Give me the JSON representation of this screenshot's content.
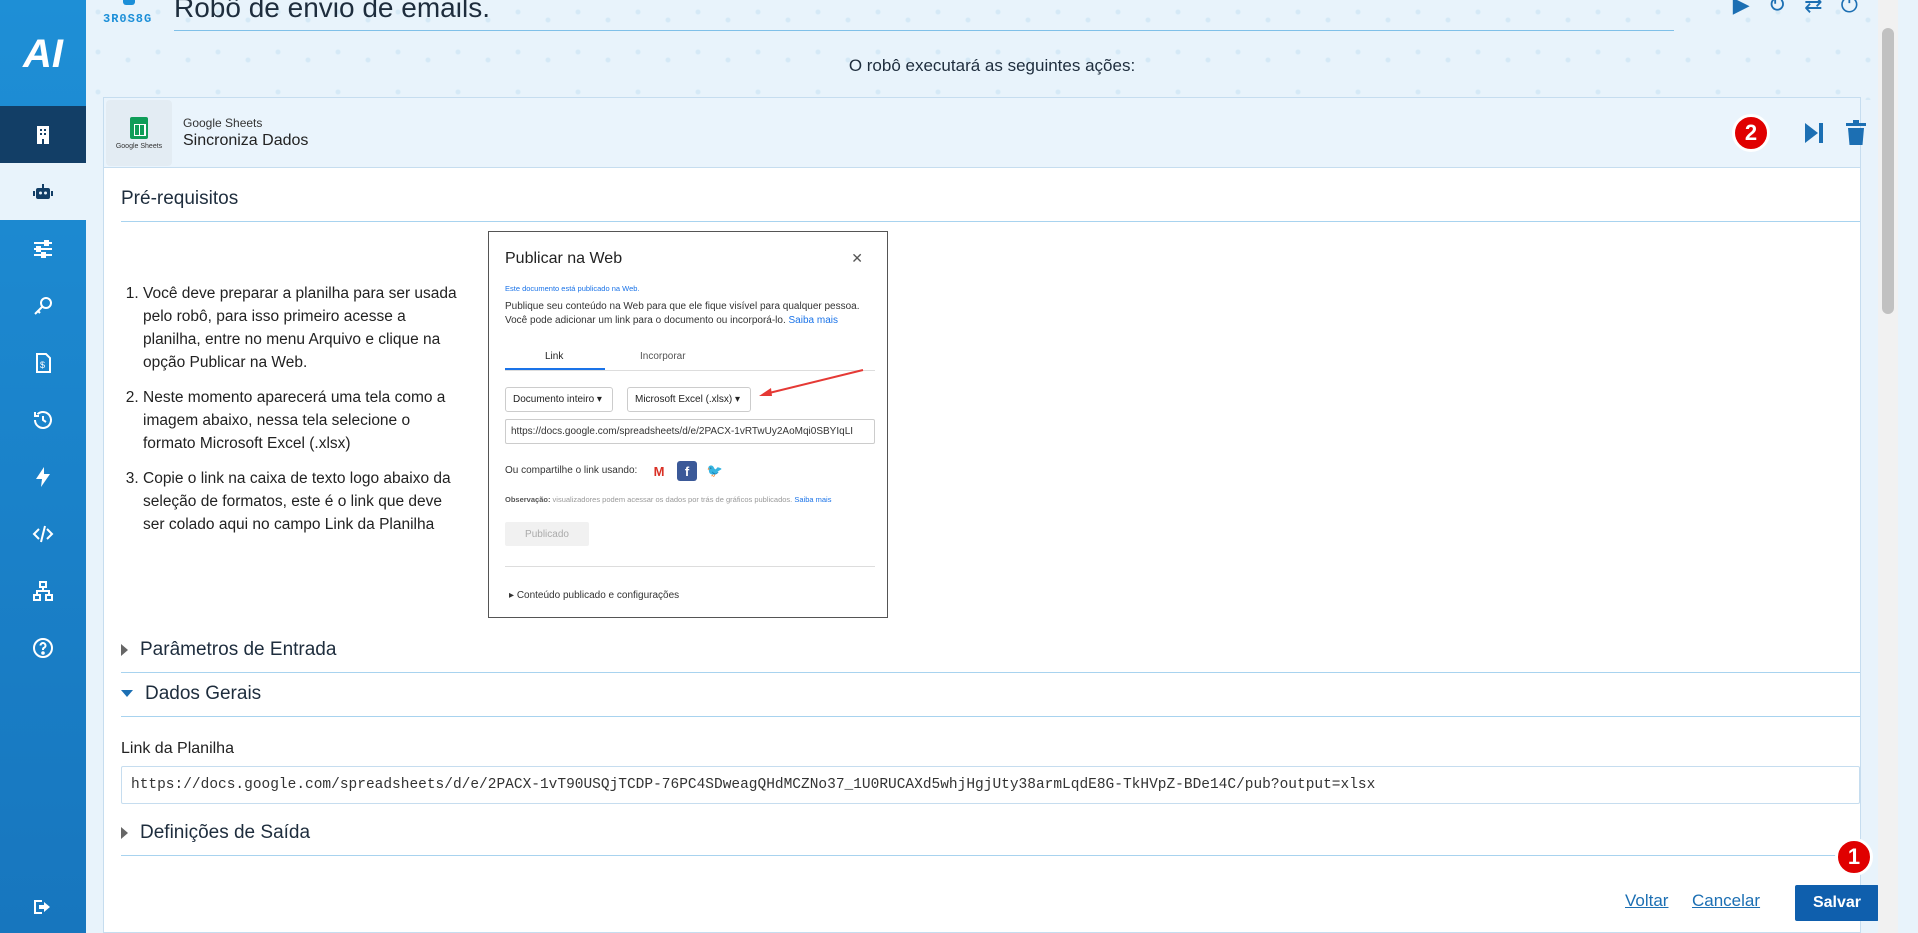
{
  "sidebar": {
    "logo": "AI",
    "items": [
      {
        "name": "building-icon"
      },
      {
        "name": "robot-icon"
      },
      {
        "name": "sliders-icon"
      },
      {
        "name": "key-icon"
      },
      {
        "name": "invoice-icon"
      },
      {
        "name": "history-icon"
      },
      {
        "name": "bolt-icon"
      },
      {
        "name": "code-icon"
      },
      {
        "name": "network-icon"
      },
      {
        "name": "help-icon"
      },
      {
        "name": "logout-icon"
      }
    ]
  },
  "header": {
    "robot_code": "3R0S8G",
    "title": "Robô de envio de emails.",
    "subtitle": "O robô executará as seguintes ações:"
  },
  "step": {
    "app_tile_label": "Google Sheets",
    "app_name": "Google Sheets",
    "step_name": "Sincroniza Dados",
    "annotation_badge": "2"
  },
  "prerequisites": {
    "title": "Pré-requisitos",
    "items": [
      "Você deve preparar a planilha para ser usada pelo robô, para isso primeiro acesse a planilha, entre no menu Arquivo e clique na opção Publicar na Web.",
      "Neste momento aparecerá uma tela como a imagem abaixo, nessa tela selecione o formato Microsoft Excel (.xlsx)",
      "Copie o link na caixa de texto logo abaixo da seleção de formatos, este é o link que deve ser colado aqui no campo Link da Planilha"
    ],
    "screenshot": {
      "title": "Publicar na Web",
      "published_note": "Este documento está publicado na Web.",
      "description": "Publique seu conteúdo na Web para que ele fique visível para qualquer pessoa. Você pode adicionar um link para o documento ou incorporá-lo.",
      "learn_more": "Saiba mais",
      "tab_link": "Link",
      "tab_embed": "Incorporar",
      "select_doc": "Documento inteiro",
      "select_format": "Microsoft Excel (.xlsx)",
      "url": "https://docs.google.com/spreadsheets/d/e/2PACX-1vRTwUy2AoMqi0SBYIqLI",
      "share_label": "Ou compartilhe o link usando:",
      "obs_label": "Observação:",
      "obs_text": "visualizadores podem acessar os dados por trás de gráficos publicados.",
      "obs_more": "Saiba mais",
      "published_button": "Publicado",
      "published_settings": "Conteúdo publicado e configurações"
    }
  },
  "sections": {
    "input_params": "Parâmetros de Entrada",
    "general_data": "Dados Gerais",
    "output_defs": "Definições de Saída"
  },
  "general": {
    "link_label": "Link da Planilha",
    "link_value": "https://docs.google.com/spreadsheets/d/e/2PACX-1vT90USQjTCDP-76PC4SDweagQHdMCZNo37_1U0RUCAXd5whjHgjUty38armLqdE8G-TkHVpZ-BDe14C/pub?output=xlsx"
  },
  "footer": {
    "back": "Voltar",
    "cancel": "Cancelar",
    "save": "Salvar",
    "annotation_badge": "1"
  },
  "colors": {
    "sidebar": "#1e8fd6",
    "sidebar_dark": "#123e66",
    "primary": "#0f5fad",
    "badge": "#e00000"
  }
}
